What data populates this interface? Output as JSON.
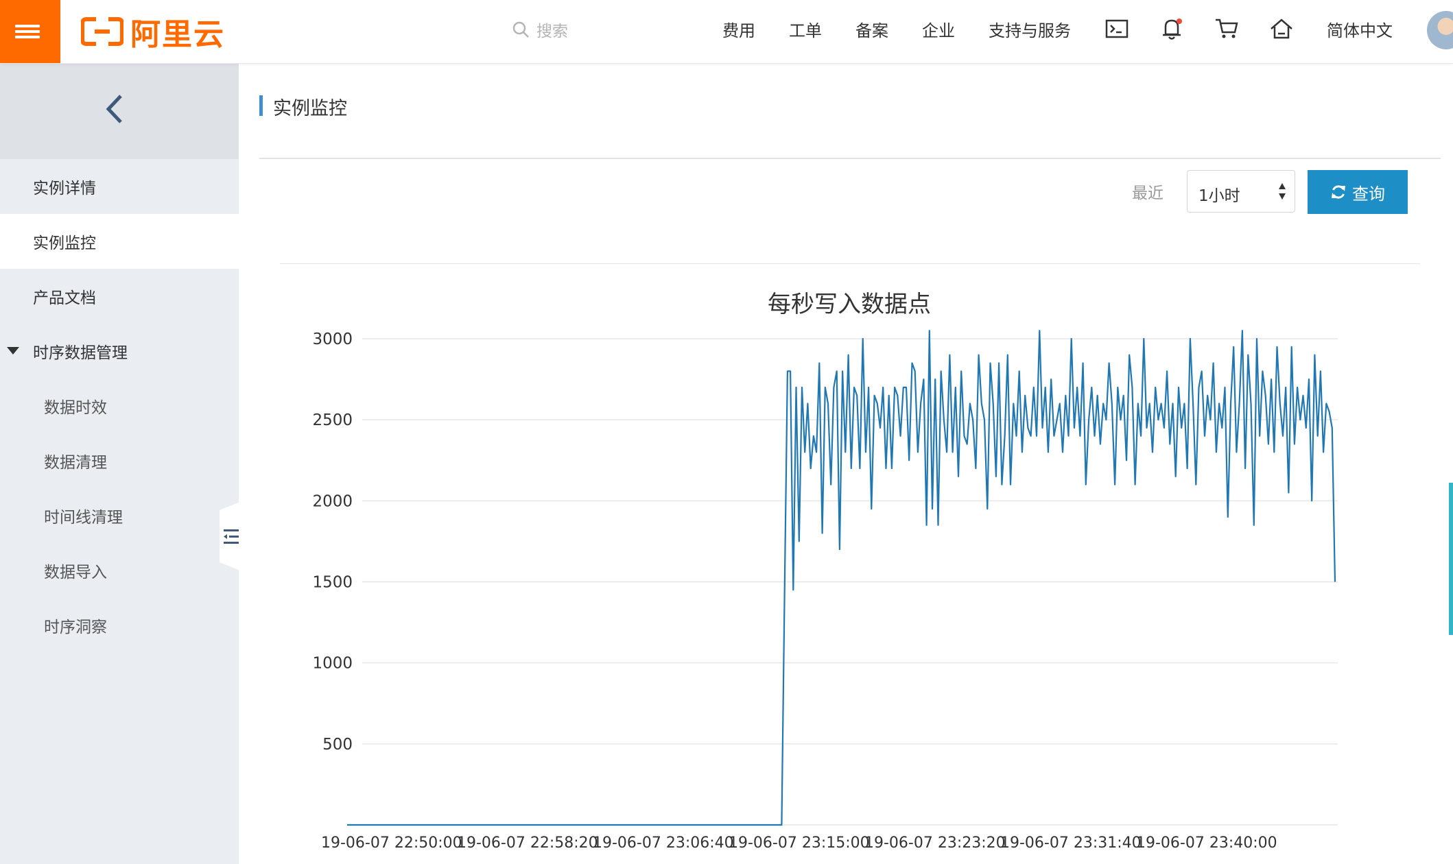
{
  "topbar": {
    "logo_text": "阿里云",
    "search_placeholder": "搜索",
    "nav": [
      "费用",
      "工单",
      "备案",
      "企业",
      "支持与服务"
    ],
    "language": "简体中文",
    "icons": [
      "terminal-icon",
      "bell-icon",
      "cart-icon",
      "home-icon"
    ],
    "accent_color": "#ff6a00"
  },
  "sidebar": {
    "items": [
      {
        "label": "实例详情",
        "active": false
      },
      {
        "label": "实例监控",
        "active": true
      },
      {
        "label": "产品文档",
        "active": false
      },
      {
        "label": "时序数据管理",
        "active": false,
        "expanded": true
      }
    ],
    "sub_items": [
      "数据时效",
      "数据清理",
      "时间线清理",
      "数据导入",
      "时序洞察"
    ]
  },
  "main": {
    "page_title": "实例监控",
    "recent_label": "最近",
    "range_select": "1小时",
    "query_button": "查询",
    "button_color": "#1e8fc6"
  },
  "chart_data": {
    "type": "line",
    "title": "每秒写入数据点",
    "line_color": "#1f77b4",
    "ylim": [
      0,
      3000
    ],
    "y_ticks": [
      500,
      1000,
      1500,
      2000,
      2500,
      3000
    ],
    "x_ticks": [
      "19-06-07 22:50:00",
      "19-06-07 22:58:20",
      "19-06-07 23:06:40",
      "19-06-07 23:15:00",
      "19-06-07 23:23:20",
      "19-06-07 23:31:40",
      "19-06-07 23:40:00"
    ],
    "grid": true,
    "series": [
      {
        "values": [
          0,
          0,
          0,
          0,
          0,
          0,
          0,
          0,
          0,
          0,
          0,
          0,
          0,
          0,
          0,
          0,
          0,
          0,
          0,
          0,
          0,
          0,
          0,
          0,
          0,
          0,
          0,
          0,
          0,
          0,
          0,
          0,
          0,
          0,
          0,
          0,
          0,
          0,
          0,
          0,
          0,
          0,
          0,
          0,
          0,
          0,
          0,
          0,
          0,
          0,
          0,
          0,
          0,
          0,
          0,
          0,
          0,
          0,
          0,
          0,
          0,
          0,
          0,
          0,
          0,
          0,
          0,
          0,
          0,
          0,
          0,
          0,
          0,
          0,
          0,
          0,
          0,
          0,
          0,
          0,
          0,
          0,
          0,
          0,
          0,
          0,
          0,
          0,
          0,
          0,
          0,
          0,
          0,
          0,
          0,
          0,
          0,
          0,
          0,
          0,
          0,
          0,
          0,
          0,
          0,
          0,
          0,
          0,
          0,
          0,
          0,
          0,
          0,
          0,
          0,
          0,
          0,
          0,
          0,
          0,
          0,
          0,
          0,
          0,
          0,
          0,
          0,
          0,
          0,
          0,
          0,
          0,
          0,
          0,
          0,
          0,
          0,
          0,
          0,
          0,
          0,
          0,
          0,
          0,
          0,
          0,
          0,
          0,
          0,
          0,
          0,
          1450,
          2800,
          2800,
          1450,
          2700,
          1750,
          2700,
          2300,
          2600,
          2200,
          2400,
          2300,
          2850,
          1800,
          2700,
          2600,
          2100,
          2700,
          2800,
          1700,
          2800,
          2300,
          2900,
          2200,
          2700,
          2650,
          2200,
          3000,
          2300,
          2700,
          1950,
          2650,
          2600,
          2450,
          2700,
          2200,
          2650,
          2200,
          2700,
          2650,
          2400,
          2700,
          2700,
          2250,
          2850,
          2800,
          2300,
          2600,
          2750,
          1850,
          3050,
          1950,
          2750,
          1850,
          2800,
          2500,
          2300,
          2900,
          2300,
          2700,
          2150,
          2800,
          2400,
          2350,
          2600,
          2500,
          2200,
          2900,
          2600,
          2500,
          1950,
          2850,
          2600,
          2150,
          2850,
          2100,
          2400,
          2900,
          2100,
          2600,
          2400,
          2800,
          2300,
          2650,
          2450,
          2400,
          2700,
          2400,
          3050,
          2450,
          2700,
          2300,
          2750,
          2400,
          2500,
          2600,
          2300,
          2650,
          2400,
          3000,
          2450,
          2700,
          2400,
          2850,
          2100,
          2500,
          2700,
          2400,
          2650,
          2350,
          2600,
          2500,
          2850,
          2600,
          2100,
          2700,
          2500,
          2650,
          2250,
          2900,
          2700,
          2100,
          2600,
          2400,
          3000,
          2450,
          2600,
          2300,
          2700,
          2500,
          2600,
          2450,
          2800,
          2350,
          2600,
          2150,
          2700,
          2450,
          2600,
          2200,
          3000,
          2600,
          2100,
          2700,
          2800,
          2400,
          2650,
          2500,
          2850,
          2300,
          2600,
          2450,
          2700,
          1900,
          2600,
          2950,
          2300,
          2600,
          3050,
          2200,
          2900,
          2600,
          1850,
          3000,
          2400,
          2800,
          2650,
          2350,
          2750,
          2300,
          2950,
          2600,
          2400,
          2700,
          2050,
          2950,
          2350,
          2700,
          2500,
          2650,
          2450,
          2750,
          2000,
          2900,
          2400,
          2800,
          2300,
          2600,
          2550,
          2450,
          1500
        ]
      }
    ]
  }
}
